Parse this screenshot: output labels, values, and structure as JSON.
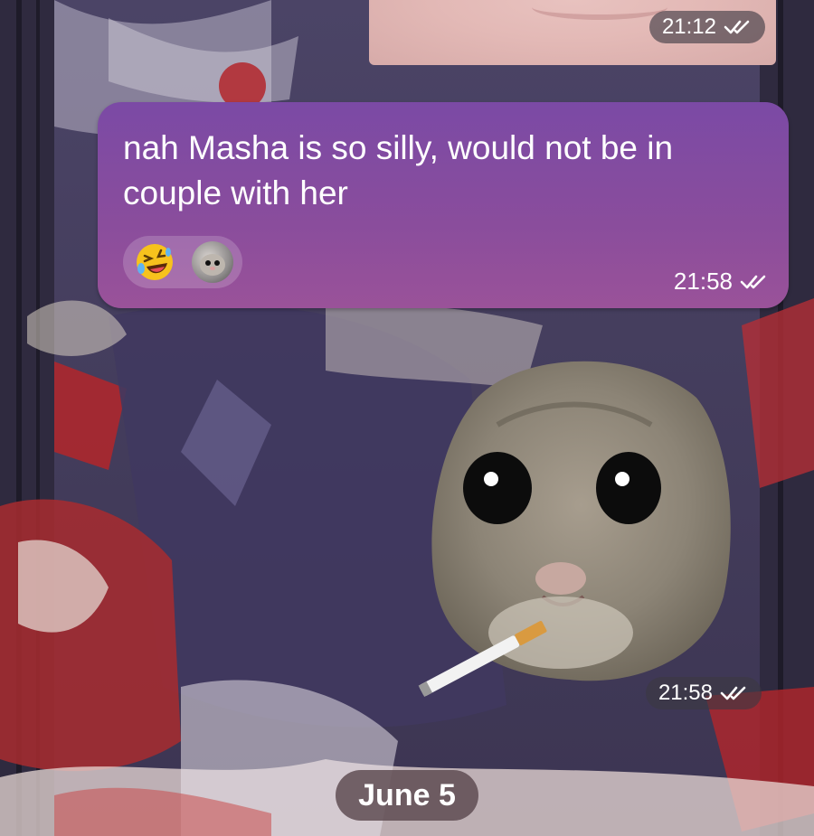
{
  "chat": {
    "photo_message": {
      "time": "21:12",
      "status": "read",
      "status_icon": "double-check-icon"
    },
    "text_message": {
      "text": "nah Masha is so silly, would not be in couple with her",
      "time": "21:58",
      "status": "read",
      "status_icon": "double-check-icon",
      "reactions": [
        {
          "emoji": "🤣",
          "icon": "rolling-laughing-emoji"
        },
        {
          "icon": "hamster-avatar"
        }
      ]
    },
    "sticker_message": {
      "sticker": "sad-hamster-smoking-sticker",
      "time": "21:58",
      "status": "read",
      "status_icon": "double-check-icon"
    },
    "date_separator": "June 5"
  },
  "colors": {
    "bubble_top": "#7b4aa5",
    "bubble_bottom": "#9a5299",
    "pill_bg": "#3c3842",
    "date_chip_bg": "#5c484e"
  }
}
